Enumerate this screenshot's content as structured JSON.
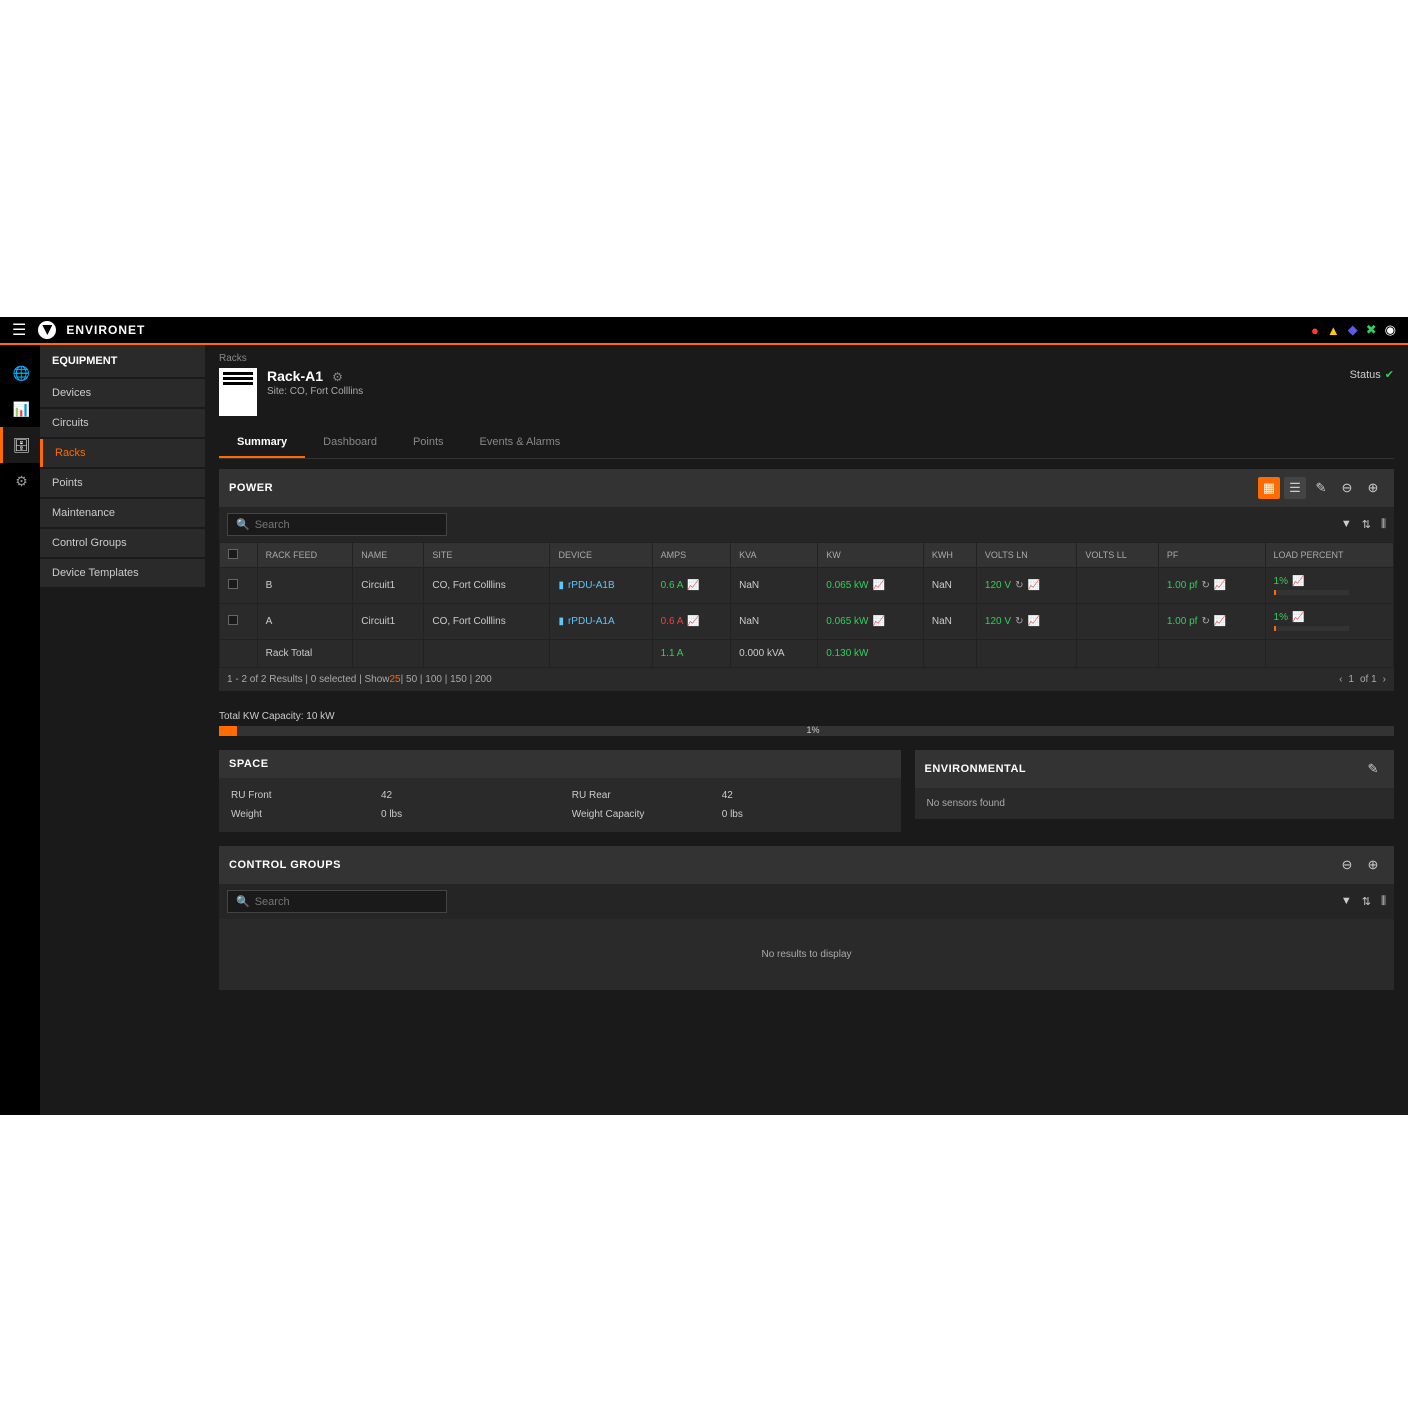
{
  "brand": "ENVIRONET",
  "sidebar": {
    "header": "EQUIPMENT",
    "items": [
      "Devices",
      "Circuits",
      "Racks",
      "Points",
      "Maintenance",
      "Control Groups",
      "Device Templates"
    ],
    "activeIndex": 2
  },
  "breadcrumb": "Racks",
  "rack": {
    "title": "Rack-A1",
    "site": "Site: CO, Fort Colllins",
    "statusLabel": "Status"
  },
  "tabs": [
    "Summary",
    "Dashboard",
    "Points",
    "Events & Alarms"
  ],
  "power": {
    "title": "POWER",
    "searchPlaceholder": "Search",
    "columns": [
      "",
      "RACK FEED",
      "NAME",
      "SITE",
      "DEVICE",
      "AMPS",
      "KVA",
      "KW",
      "KWH",
      "VOLTS LN",
      "VOLTS LL",
      "PF",
      "LOAD PERCENT"
    ],
    "rows": [
      {
        "feed": "B",
        "name": "Circuit1",
        "site": "CO, Fort Colllins",
        "device": "rPDU-A1B",
        "amps": "0.6 A",
        "ampsClass": "val-green",
        "kva": "NaN",
        "kw": "0.065 kW",
        "kwh": "NaN",
        "voltsln": "120 V",
        "voltsll": "",
        "pf": "1.00 pf",
        "load": "1%"
      },
      {
        "feed": "A",
        "name": "Circuit1",
        "site": "CO, Fort Colllins",
        "device": "rPDU-A1A",
        "amps": "0.6 A",
        "ampsClass": "val-red",
        "kva": "NaN",
        "kw": "0.065 kW",
        "kwh": "NaN",
        "voltsln": "120 V",
        "voltsll": "",
        "pf": "1.00 pf",
        "load": "1%"
      }
    ],
    "totalRow": {
      "label": "Rack Total",
      "amps": "1.1 A",
      "kva": "0.000 kVA",
      "kw": "0.130 kW"
    },
    "pagerText1": "1 - 2 of 2 Results | 0 selected | Show ",
    "pagerHL": "25",
    "pagerText2": " | 50 | 100 | 150 | 200",
    "page": "1",
    "pageOf": "of 1"
  },
  "kw": {
    "label": "Total KW Capacity: 10 kW",
    "pct": "1%"
  },
  "space": {
    "title": "SPACE",
    "ruFrontLabel": "RU Front",
    "ruFront": "42",
    "ruRearLabel": "RU Rear",
    "ruRear": "42",
    "weightLabel": "Weight",
    "weight": "0 lbs",
    "weightCapLabel": "Weight Capacity",
    "weightCap": "0 lbs"
  },
  "env": {
    "title": "ENVIRONMENTAL",
    "body": "No sensors found"
  },
  "cg": {
    "title": "CONTROL GROUPS",
    "searchPlaceholder": "Search",
    "empty": "No results to display"
  }
}
